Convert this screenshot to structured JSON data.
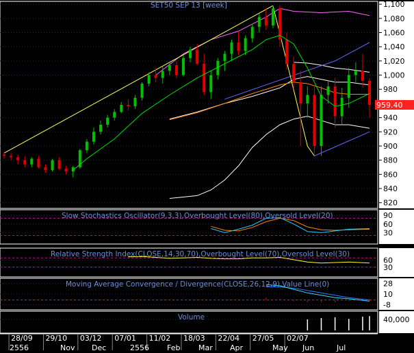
{
  "chart_data": {
    "type": "candlestick",
    "title": "SET50 SEP 13   [week]",
    "last_price_label": "959.40",
    "colors": {
      "up": "#00c000",
      "down": "#e00000",
      "ma": "#ff8800",
      "ma2": "#00dd00",
      "band": "#ffffff",
      "env": "#ff66ff",
      "trend": "#ffff55",
      "channel": "#6666ff"
    },
    "main": {
      "y_ticks": [
        "1,100",
        "1,080",
        "1,060",
        "1,040",
        "1,020",
        "1,000",
        "980",
        "960",
        "940",
        "920",
        "900",
        "880",
        "860",
        "840",
        "820"
      ],
      "ylim": [
        812,
        1104
      ],
      "candles": [
        [
          888,
          892,
          882,
          886
        ],
        [
          886,
          890,
          880,
          884
        ],
        [
          884,
          888,
          874,
          880
        ],
        [
          880,
          886,
          870,
          874
        ],
        [
          874,
          884,
          870,
          882
        ],
        [
          882,
          886,
          868,
          870
        ],
        [
          870,
          874,
          862,
          866
        ],
        [
          866,
          882,
          864,
          880
        ],
        [
          880,
          884,
          866,
          868
        ],
        [
          868,
          872,
          860,
          864
        ],
        [
          864,
          872,
          856,
          870
        ],
        [
          870,
          896,
          868,
          894
        ],
        [
          894,
          910,
          890,
          906
        ],
        [
          906,
          926,
          902,
          920
        ],
        [
          920,
          936,
          916,
          930
        ],
        [
          930,
          944,
          926,
          940
        ],
        [
          940,
          952,
          936,
          948
        ],
        [
          948,
          962,
          946,
          958
        ],
        [
          958,
          966,
          950,
          956
        ],
        [
          956,
          972,
          952,
          968
        ],
        [
          968,
          990,
          964,
          988
        ],
        [
          988,
          1004,
          984,
          1000
        ],
        [
          1000,
          1010,
          990,
          996
        ],
        [
          996,
          1012,
          988,
          1006
        ],
        [
          1006,
          1018,
          1000,
          1014
        ],
        [
          1014,
          1020,
          996,
          1000
        ],
        [
          1000,
          1028,
          998,
          1024
        ],
        [
          1024,
          1040,
          1018,
          1036
        ],
        [
          1036,
          1044,
          1014,
          1016
        ],
        [
          1016,
          1030,
          972,
          976
        ],
        [
          976,
          1006,
          966,
          1000
        ],
        [
          1000,
          1024,
          994,
          1020
        ],
        [
          1020,
          1034,
          1006,
          1030
        ],
        [
          1030,
          1050,
          1020,
          1046
        ],
        [
          1046,
          1062,
          1028,
          1034
        ],
        [
          1034,
          1056,
          1028,
          1052
        ],
        [
          1052,
          1072,
          1046,
          1068
        ],
        [
          1068,
          1086,
          1060,
          1082
        ],
        [
          1082,
          1094,
          1064,
          1070
        ],
        [
          1070,
          1098,
          1066,
          1094
        ],
        [
          1094,
          1098,
          1040,
          1050
        ],
        [
          1050,
          1060,
          1008,
          1016
        ],
        [
          1016,
          1026,
          980,
          990
        ],
        [
          990,
          1006,
          900,
          960
        ],
        [
          960,
          984,
          940,
          972
        ],
        [
          972,
          986,
          888,
          900
        ],
        [
          900,
          984,
          886,
          972
        ],
        [
          972,
          992,
          960,
          984
        ],
        [
          984,
          996,
          926,
          942
        ],
        [
          942,
          982,
          930,
          968
        ],
        [
          968,
          1010,
          954,
          1000
        ],
        [
          1000,
          1018,
          990,
          1006
        ],
        [
          1006,
          1030,
          982,
          992
        ],
        [
          992,
          996,
          940,
          958
        ]
      ],
      "sma_orange": [
        null,
        null,
        null,
        null,
        null,
        null,
        null,
        null,
        null,
        null,
        null,
        null,
        null,
        null,
        null,
        null,
        null,
        null,
        null,
        null,
        null,
        null,
        null,
        null,
        null,
        null,
        null,
        null,
        null,
        null,
        null,
        null,
        null,
        null,
        null,
        null,
        null,
        null,
        null,
        null,
        null,
        null,
        null,
        null,
        null,
        null,
        null,
        null,
        null,
        null,
        null,
        null,
        null,
        null
      ],
      "sma_orange_pts": [
        [
          24,
          937
        ],
        [
          28,
          947
        ],
        [
          32,
          960
        ],
        [
          36,
          974
        ],
        [
          40,
          986
        ],
        [
          42,
          990
        ],
        [
          44,
          988
        ],
        [
          46,
          982
        ],
        [
          48,
          975
        ],
        [
          50,
          973
        ],
        [
          53,
          973
        ]
      ],
      "sma_green_pts": [
        [
          10,
          866
        ],
        [
          12,
          882
        ],
        [
          16,
          910
        ],
        [
          20,
          946
        ],
        [
          24,
          972
        ],
        [
          28,
          996
        ],
        [
          32,
          1016
        ],
        [
          36,
          1036
        ],
        [
          38,
          1050
        ],
        [
          40,
          1056
        ],
        [
          42,
          1044
        ],
        [
          44,
          1010
        ],
        [
          46,
          970
        ],
        [
          48,
          956
        ],
        [
          50,
          960
        ],
        [
          53,
          974
        ]
      ],
      "band_low_pts": [
        [
          24,
          826
        ],
        [
          28,
          830
        ],
        [
          30,
          838
        ],
        [
          32,
          852
        ],
        [
          34,
          872
        ],
        [
          36,
          898
        ],
        [
          38,
          916
        ],
        [
          40,
          930
        ],
        [
          42,
          938
        ],
        [
          44,
          942
        ],
        [
          46,
          936
        ],
        [
          48,
          930
        ],
        [
          50,
          930
        ],
        [
          53,
          925
        ]
      ],
      "band_up_pts": [
        [
          22,
          1000
        ],
        [
          26,
          1030
        ],
        [
          30,
          1052
        ],
        [
          34,
          1066
        ],
        [
          38,
          1082
        ],
        [
          40,
          1090
        ],
        [
          42,
          1090
        ],
        [
          44,
          1090
        ],
        [
          46,
          1090
        ],
        [
          48,
          1090
        ],
        [
          50,
          1086
        ],
        [
          53,
          1084
        ]
      ],
      "white_upper_pts": [
        [
          42,
          1018
        ],
        [
          44,
          1017
        ],
        [
          46,
          1014
        ],
        [
          48,
          1010
        ],
        [
          50,
          1008
        ],
        [
          53,
          1004
        ]
      ],
      "white_lower_pts": [
        [
          24,
          938
        ],
        [
          28,
          948
        ],
        [
          32,
          960
        ],
        [
          36,
          970
        ],
        [
          40,
          982
        ],
        [
          42,
          994
        ],
        [
          44,
          998
        ],
        [
          46,
          994
        ],
        [
          48,
          990
        ],
        [
          50,
          990
        ],
        [
          53,
          986
        ]
      ],
      "trend_up_pts": [
        [
          0,
          890
        ],
        [
          39,
          1098
        ]
      ],
      "trend_down_pts": [
        [
          39,
          1098
        ],
        [
          44,
          900
        ],
        [
          45,
          886
        ]
      ],
      "channel_upper_pts": [
        [
          32,
          966
        ],
        [
          48,
          1020
        ],
        [
          53,
          1046
        ]
      ],
      "channel_lower_pts": [
        [
          45,
          886
        ],
        [
          53,
          920
        ]
      ],
      "env_pts": [
        [
          22,
          1000
        ],
        [
          26,
          1030
        ],
        [
          30,
          1050
        ],
        [
          34,
          1062
        ],
        [
          38,
          1082
        ],
        [
          40,
          1094
        ],
        [
          42,
          1090
        ],
        [
          46,
          1088
        ],
        [
          50,
          1090
        ],
        [
          53,
          1084
        ]
      ]
    },
    "panels": [
      {
        "title": "Slow Stochastics Oscillator(9,3,3),Overbought Level(80),Oversold Level(20)",
        "y_ticks": [
          "90",
          "60",
          "30"
        ],
        "ylim": [
          0,
          100
        ],
        "k": [
          [
            30,
            44
          ],
          [
            32,
            30
          ],
          [
            34,
            42
          ],
          [
            36,
            56
          ],
          [
            38,
            80
          ],
          [
            40,
            82
          ],
          [
            42,
            60
          ],
          [
            44,
            34
          ],
          [
            46,
            30
          ],
          [
            48,
            36
          ],
          [
            50,
            42
          ],
          [
            53,
            44
          ]
        ],
        "d": [
          [
            30,
            52
          ],
          [
            32,
            38
          ],
          [
            34,
            36
          ],
          [
            36,
            48
          ],
          [
            38,
            68
          ],
          [
            40,
            80
          ],
          [
            42,
            72
          ],
          [
            44,
            50
          ],
          [
            46,
            40
          ],
          [
            48,
            38
          ],
          [
            50,
            40
          ],
          [
            53,
            42
          ]
        ]
      },
      {
        "title": "Relative Strength Index(CLOSE,14,30,70),Overbought Level(70),Oversold Level(30)",
        "y_ticks": [
          "60",
          "30"
        ],
        "ylim": [
          0,
          100
        ],
        "rsi": [
          [
            18,
            74
          ],
          [
            20,
            76
          ],
          [
            22,
            72
          ],
          [
            24,
            68
          ],
          [
            26,
            70
          ],
          [
            28,
            72
          ],
          [
            30,
            68
          ],
          [
            32,
            66
          ],
          [
            34,
            66
          ],
          [
            36,
            70
          ],
          [
            38,
            70
          ],
          [
            40,
            72
          ],
          [
            42,
            62
          ],
          [
            44,
            52
          ],
          [
            46,
            48
          ],
          [
            48,
            50
          ],
          [
            50,
            52
          ],
          [
            53,
            48
          ]
        ]
      },
      {
        "title": "Moving Average Convergence / Divergence(CLOSE,26,12,9),Value Line(0)",
        "y_ticks": [
          "28",
          "10",
          "-8"
        ],
        "ylim": [
          -12,
          32
        ],
        "macd": [
          [
            38,
            26
          ],
          [
            40,
            24
          ],
          [
            42,
            18
          ],
          [
            44,
            12
          ],
          [
            46,
            8
          ],
          [
            48,
            4
          ],
          [
            50,
            2
          ],
          [
            53,
            -2
          ]
        ],
        "signal": [
          [
            38,
            22
          ],
          [
            40,
            22
          ],
          [
            42,
            20
          ],
          [
            44,
            16
          ],
          [
            46,
            12
          ],
          [
            48,
            8
          ],
          [
            50,
            4
          ],
          [
            53,
            0
          ]
        ]
      },
      {
        "title": "Volume",
        "y_ticks": [
          "40,000"
        ],
        "ylim": [
          0,
          60000
        ],
        "values_pts": [
          [
            44,
            40000
          ],
          [
            46,
            45000
          ],
          [
            48,
            48000
          ],
          [
            50,
            42000
          ],
          [
            52,
            50000
          ],
          [
            53,
            52000
          ]
        ]
      }
    ],
    "x_ticks": [
      "28/09",
      "29/10",
      "03/12",
      "07/01",
      "11/02",
      "18/03",
      "22/04",
      "27/05",
      "02/07"
    ],
    "month_labels": [
      "2556",
      "Nov",
      "Dec",
      "2556",
      "Feb",
      "Mar",
      "Apr",
      "May",
      "Jun",
      "Jul"
    ],
    "year_label": "2556"
  }
}
